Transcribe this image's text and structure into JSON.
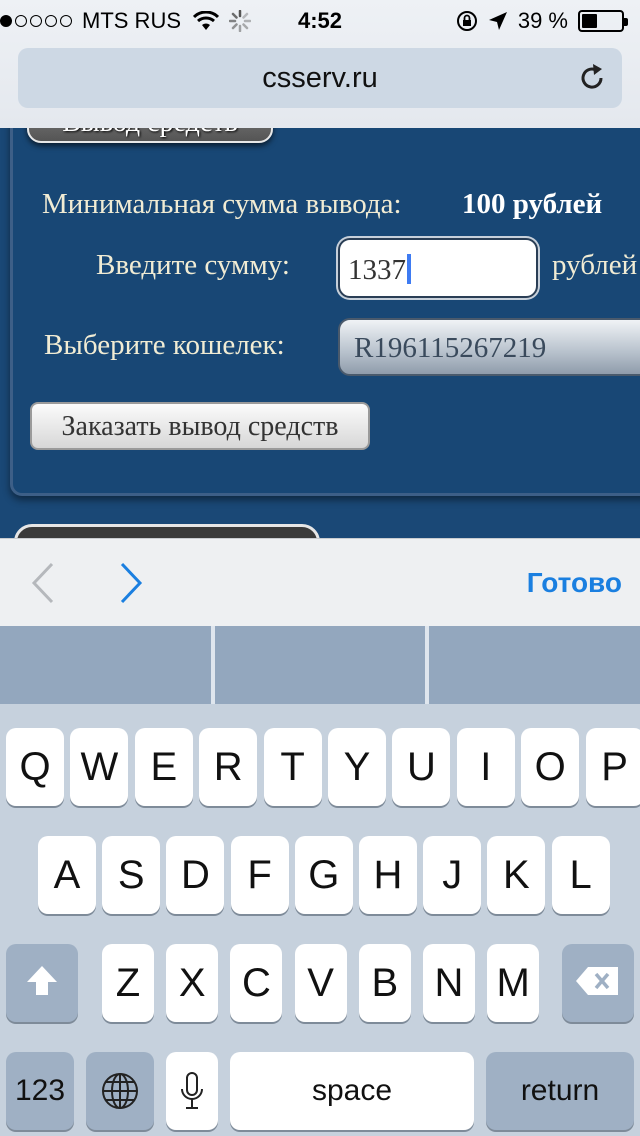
{
  "status_bar": {
    "signal_dots_filled": 1,
    "signal_dots_total": 5,
    "carrier": "MTS RUS",
    "time": "4:52",
    "battery": "39 %",
    "battery_level": 0.39
  },
  "browser": {
    "url": "csserv.ru"
  },
  "page": {
    "section_tab": "Вывод средств",
    "min_label": "Минимальная сумма вывода:",
    "min_value": "100 рублей",
    "amount_label": "Введите сумму:",
    "amount_value": "1337",
    "amount_unit": "рублей",
    "wallet_label": "Выберите кошелек:",
    "wallet_value": "R196115267219",
    "order_button": "Заказать вывод средств"
  },
  "accessory_bar": {
    "done": "Готово"
  },
  "keyboard": {
    "row1": [
      "Q",
      "W",
      "E",
      "R",
      "T",
      "Y",
      "U",
      "I",
      "O",
      "P"
    ],
    "row2": [
      "A",
      "S",
      "D",
      "F",
      "G",
      "H",
      "J",
      "K",
      "L"
    ],
    "row3": [
      "Z",
      "X",
      "C",
      "V",
      "B",
      "N",
      "M"
    ],
    "numbers": "123",
    "space": "space",
    "return": "return"
  },
  "colors": {
    "page_background": "#1a4876",
    "accent": "#1a7fe0"
  }
}
